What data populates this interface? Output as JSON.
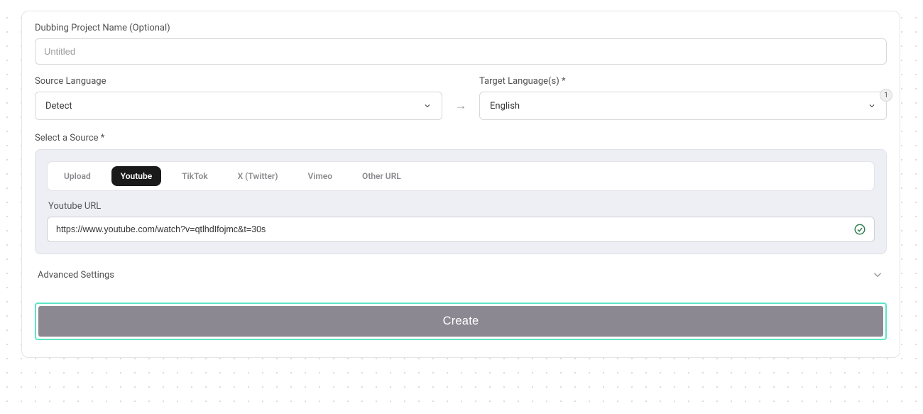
{
  "project_name": {
    "label": "Dubbing Project Name (Optional)",
    "placeholder": "Untitled",
    "value": ""
  },
  "source_language": {
    "label": "Source Language",
    "value": "Detect"
  },
  "target_language": {
    "label": "Target Language(s) *",
    "value": "English",
    "count": "1"
  },
  "arrow": "→",
  "source": {
    "label": "Select a Source *",
    "tabs": {
      "upload": "Upload",
      "youtube": "Youtube",
      "tiktok": "TikTok",
      "x": "X (Twitter)",
      "vimeo": "Vimeo",
      "other": "Other URL"
    },
    "url_label": "Youtube URL",
    "url_value": "https://www.youtube.com/watch?v=qtlhdIfojmc&t=30s"
  },
  "advanced": {
    "label": "Advanced Settings"
  },
  "create_button": "Create"
}
